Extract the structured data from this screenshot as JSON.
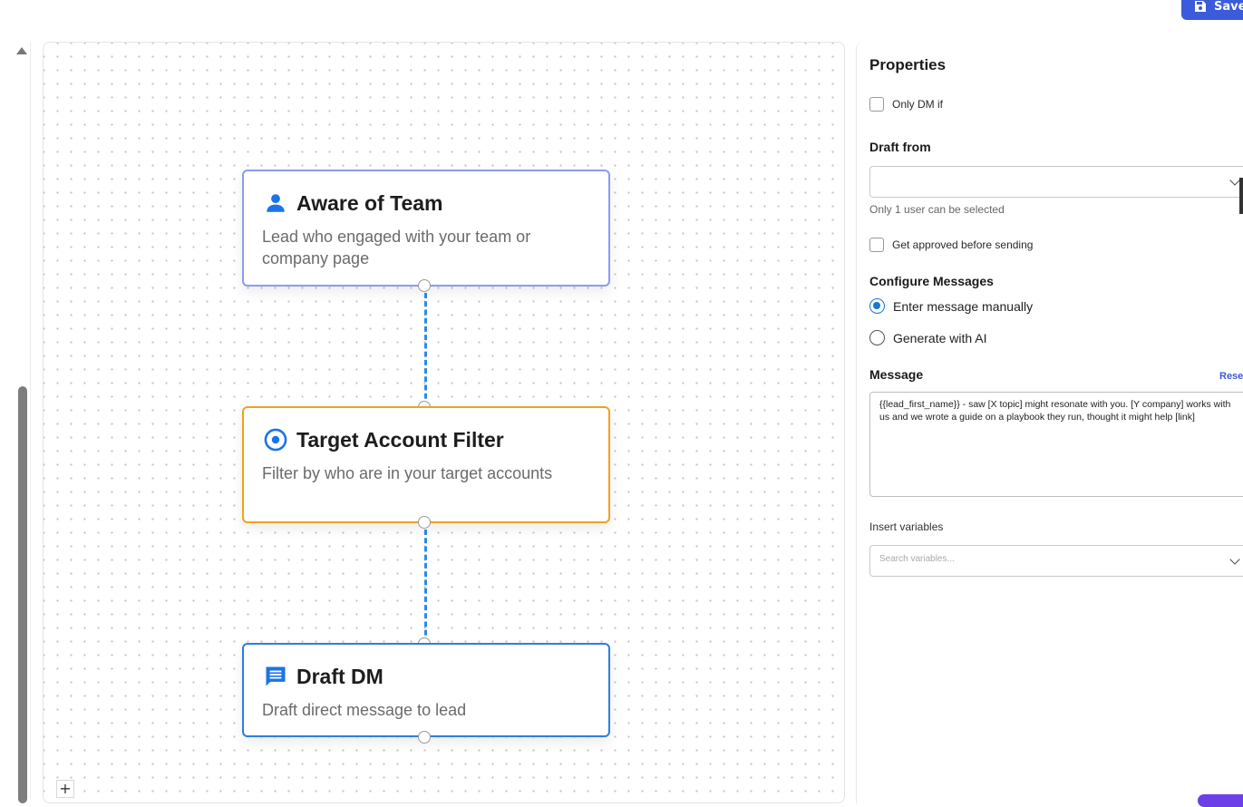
{
  "toolbar": {
    "save_label": "Save",
    "save_color": "#3b5bdb"
  },
  "canvas": {
    "nodes": [
      {
        "id": "aware",
        "icon": "person-icon",
        "title": "Aware of Team",
        "description": "Lead who engaged with your team or company page",
        "border_color": "#8c9bf0"
      },
      {
        "id": "target",
        "icon": "target-icon",
        "title": "Target Account Filter",
        "description": "Filter by who are in your target accounts",
        "border_color": "#f0a21f"
      },
      {
        "id": "draft",
        "icon": "message-icon",
        "title": "Draft DM",
        "description": "Draft direct message to lead",
        "border_color": "#2b7fe0"
      }
    ],
    "zoom_in_label": "+"
  },
  "properties": {
    "title": "Properties",
    "only_dm_if": {
      "label": "Only DM if",
      "checked": false
    },
    "draft_from": {
      "label": "Draft from",
      "value": "",
      "hint": "Only 1 user can be selected"
    },
    "get_approved": {
      "label": "Get approved before sending",
      "checked": false
    },
    "configure_messages": {
      "label": "Configure Messages",
      "options": [
        {
          "label": "Enter message manually",
          "selected": true
        },
        {
          "label": "Generate with AI",
          "selected": false
        }
      ]
    },
    "message": {
      "label": "Message",
      "reset_label": "Reset",
      "value": "{{lead_first_name}} - saw [X topic] might resonate with you. [Y company] works with us and we wrote a guide on a playbook they run, thought it might help [link]"
    },
    "insert_variables": {
      "label": "Insert variables",
      "placeholder": "Search variables..."
    }
  }
}
